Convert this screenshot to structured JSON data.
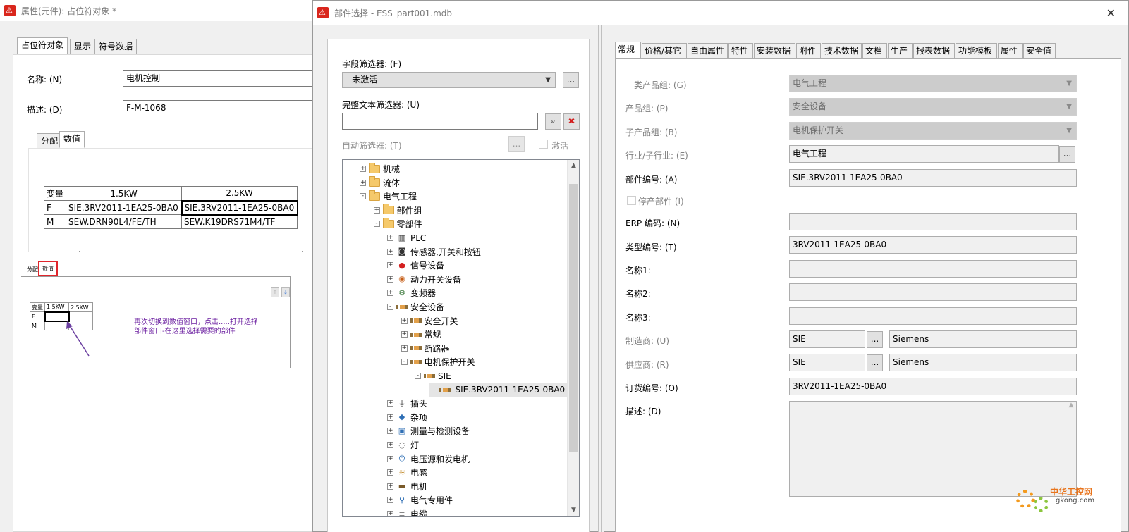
{
  "props_window": {
    "title": "属性(元件): 占位符对象 *",
    "tabs": [
      "占位符对象",
      "显示",
      "符号数据"
    ],
    "name_label": "名称: (N)",
    "name_value": "电机控制",
    "desc_label": "描述: (D)",
    "desc_value": "F-M-1068",
    "sub_tabs": [
      "分配",
      "数值"
    ],
    "table": {
      "headers": [
        "变量",
        "1.5KW",
        "2.5KW"
      ],
      "rows": [
        [
          "F",
          "SIE.3RV2011-1EA25-0BA0",
          "SIE.3RV2011-1EA25-0BA0"
        ],
        [
          "M",
          "SEW.DRN90L4/FE/TH",
          "SEW.K19DRS71M4/TF"
        ]
      ]
    },
    "inset": {
      "tabs": [
        "分配",
        "数值"
      ],
      "headers": [
        "变量",
        "1.5KW",
        "2.5KW"
      ],
      "rows": [
        [
          "F",
          "...",
          ""
        ],
        [
          "M",
          "",
          ""
        ]
      ],
      "note_line1": "再次切换到数值窗口，点击.....打开选择",
      "note_line2": "部件窗口-在这里选择需要的部件"
    }
  },
  "dialog": {
    "title": "部件选择 - ESS_part001.mdb",
    "field_filter_label": "字段筛选器: (F)",
    "field_filter_value": "- 未激活 -",
    "fulltext_label": "完整文本筛选器: (U)",
    "fulltext_value": "",
    "auto_filter_label": "自动筛选器: (T)",
    "activate_label": "激活",
    "ellipsis": "...",
    "tree": [
      {
        "label": "机械",
        "level": 1,
        "exp": "+",
        "icon": "folder-icon"
      },
      {
        "label": "流体",
        "level": 1,
        "exp": "+",
        "icon": "folder-icon"
      },
      {
        "label": "电气工程",
        "level": 1,
        "exp": "-",
        "icon": "folder-icon"
      },
      {
        "label": "部件组",
        "level": 2,
        "exp": "+",
        "icon": "folder-icon"
      },
      {
        "label": "零部件",
        "level": 2,
        "exp": "-",
        "icon": "folder-icon"
      },
      {
        "label": "PLC",
        "level": 3,
        "exp": "+",
        "icon": "plc-icon"
      },
      {
        "label": "传感器,开关和按钮",
        "level": 3,
        "exp": "+",
        "icon": "sensor-icon"
      },
      {
        "label": "信号设备",
        "level": 3,
        "exp": "+",
        "icon": "signal-icon"
      },
      {
        "label": "动力开关设备",
        "level": 3,
        "exp": "+",
        "icon": "power-switch-icon"
      },
      {
        "label": "变频器",
        "level": 3,
        "exp": "+",
        "icon": "inverter-icon"
      },
      {
        "label": "安全设备",
        "level": 3,
        "exp": "-",
        "icon": "part-icon"
      },
      {
        "label": "安全开关",
        "level": 4,
        "exp": "+",
        "icon": "part-icon"
      },
      {
        "label": "常规",
        "level": 4,
        "exp": "+",
        "icon": "part-icon"
      },
      {
        "label": "断路器",
        "level": 4,
        "exp": "+",
        "icon": "part-icon"
      },
      {
        "label": "电机保护开关",
        "level": 4,
        "exp": "-",
        "icon": "part-icon"
      },
      {
        "label": "SIE",
        "level": 5,
        "exp": "-",
        "icon": "part-icon"
      },
      {
        "label": "SIE.3RV2011-1EA25-0BA0",
        "level": 6,
        "exp": "",
        "icon": "part-icon",
        "selected": true
      },
      {
        "label": "插头",
        "level": 3,
        "exp": "+",
        "icon": "plug-icon"
      },
      {
        "label": "杂项",
        "level": 3,
        "exp": "+",
        "icon": "misc-icon"
      },
      {
        "label": "测量与检测设备",
        "level": 3,
        "exp": "+",
        "icon": "meter-icon"
      },
      {
        "label": "灯",
        "level": 3,
        "exp": "+",
        "icon": "lamp-icon"
      },
      {
        "label": "电压源和发电机",
        "level": 3,
        "exp": "+",
        "icon": "generator-icon"
      },
      {
        "label": "电感",
        "level": 3,
        "exp": "+",
        "icon": "inductor-icon"
      },
      {
        "label": "电机",
        "level": 3,
        "exp": "+",
        "icon": "motor-icon"
      },
      {
        "label": "电气专用件",
        "level": 3,
        "exp": "+",
        "icon": "special-icon"
      },
      {
        "label": "电缆",
        "level": 3,
        "exp": "+",
        "icon": "cable-icon"
      }
    ],
    "right_tabs": [
      "常规",
      "价格/其它",
      "自由属性",
      "特性",
      "安装数据",
      "附件",
      "技术数据",
      "文档",
      "生产",
      "报表数据",
      "功能模板",
      "属性",
      "安全值"
    ],
    "fields": {
      "group1_label": "一类产品组: (G)",
      "group1_value": "电气工程",
      "group_label": "产品组: (P)",
      "group_value": "安全设备",
      "subgroup_label": "子产品组: (B)",
      "subgroup_value": "电机保护开关",
      "industry_label": "行业/子行业: (E)",
      "industry_value": "电气工程",
      "partno_label": "部件编号: (A)",
      "partno_value": "SIE.3RV2011-1EA25-0BA0",
      "discontinued_label": "停产部件 (I)",
      "erp_label": "ERP 编码: (N)",
      "erp_value": "",
      "type_label": "类型编号: (T)",
      "type_value": "3RV2011-1EA25-0BA0",
      "name1_label": "名称1:",
      "name1_value": "",
      "name2_label": "名称2:",
      "name2_value": "",
      "name3_label": "名称3:",
      "name3_value": "",
      "manufacturer_label": "制造商: (U)",
      "manufacturer_code": "SIE",
      "manufacturer_name": "Siemens",
      "supplier_label": "供应商: (R)",
      "supplier_code": "SIE",
      "supplier_name": "Siemens",
      "order_label": "订货编号: (O)",
      "order_value": "3RV2011-1EA25-0BA0",
      "desc_label": "描述: (D)",
      "desc_value": ""
    }
  },
  "watermark": {
    "cn": "中华工控网",
    "en": "gkong.com"
  }
}
